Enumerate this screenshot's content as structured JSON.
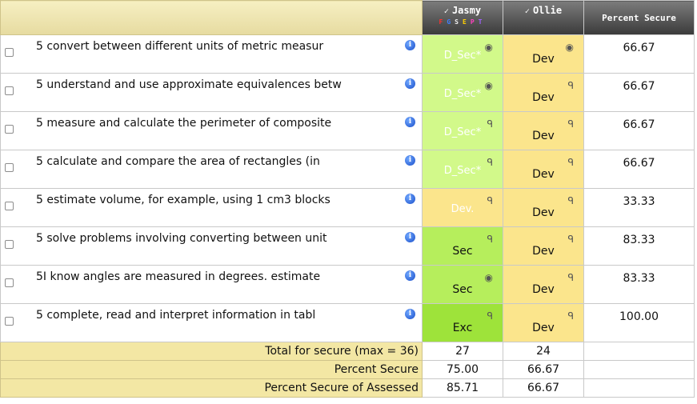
{
  "students": [
    {
      "name": "Jasmy",
      "check": "✓",
      "letters": [
        "F",
        "G",
        "S",
        "E",
        "P",
        "T"
      ]
    },
    {
      "name": "Ollie",
      "check": "✓"
    }
  ],
  "percent_header": "Percent Secure",
  "letter_colors": [
    "#ff3030",
    "#3070ff",
    "#f0f0f0",
    "#ffd000",
    "#ff40c0",
    "#a060ff"
  ],
  "objectives": [
    {
      "text": "5 convert between different units of metric measur",
      "jasmy": "D_Sec*",
      "jasmy_icon": "eye-icon",
      "ollie": "Dev",
      "ollie_icon": "eye-icon",
      "percent": "66.67"
    },
    {
      "text": "5 understand and use approximate equivalences betw",
      "jasmy": "D_Sec*",
      "jasmy_icon": "eye-icon",
      "ollie": "Dev",
      "ollie_icon": "speech-icon",
      "percent": "66.67"
    },
    {
      "text": "5 measure and calculate the perimeter of composite",
      "jasmy": "D_Sec*",
      "jasmy_icon": "speech-icon",
      "ollie": "Dev",
      "ollie_icon": "speech-icon",
      "percent": "66.67"
    },
    {
      "text": "5 calculate and compare the area of rectangles (in",
      "jasmy": "D_Sec*",
      "jasmy_icon": "speech-icon",
      "ollie": "Dev",
      "ollie_icon": "speech-icon",
      "percent": "66.67"
    },
    {
      "text": "5 estimate volume, for example, using 1 cm3 blocks",
      "jasmy": "Dev.",
      "jasmy_icon": "speech-icon",
      "ollie": "Dev",
      "ollie_icon": "speech-icon",
      "percent": "33.33"
    },
    {
      "text": "5 solve problems involving converting between unit",
      "jasmy": "Sec",
      "jasmy_icon": "speech-icon",
      "ollie": "Dev",
      "ollie_icon": "speech-icon",
      "percent": "83.33"
    },
    {
      "text": "5I know angles are measured in degrees. estimate",
      "jasmy": "Sec",
      "jasmy_icon": "eye-icon",
      "ollie": "Dev",
      "ollie_icon": "speech-icon",
      "percent": "83.33"
    },
    {
      "text": "5 complete, read and interpret information in tabl",
      "jasmy": "Exc",
      "jasmy_icon": "speech-icon",
      "ollie": "Dev",
      "ollie_icon": "speech-icon",
      "percent": "100.00"
    }
  ],
  "totals": [
    {
      "label": "Total for secure (max = 36)",
      "jasmy": "27",
      "ollie": "24"
    },
    {
      "label": "Percent Secure",
      "jasmy": "75.00",
      "ollie": "66.67"
    },
    {
      "label": "Percent Secure of Assessed",
      "jasmy": "85.71",
      "ollie": "66.67"
    }
  ],
  "icons": {
    "info": "i",
    "eye": "◉",
    "speech": "ᑫ"
  }
}
